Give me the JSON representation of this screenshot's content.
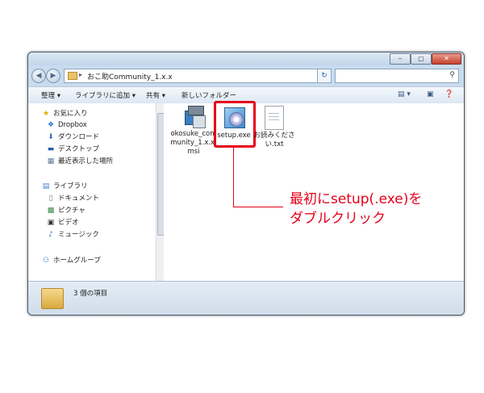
{
  "address": {
    "path": "おこ助Community_1.x.x"
  },
  "toolbar": {
    "organize": "整理 ▾",
    "add_to_library": "ライブラリに追加 ▾",
    "share": "共有 ▾",
    "new_folder": "新しいフォルダー"
  },
  "nav": {
    "favorites": "お気に入り",
    "dropbox": "Dropbox",
    "downloads": "ダウンロード",
    "desktop": "デスクトップ",
    "recent": "最近表示した場所",
    "libraries": "ライブラリ",
    "documents": "ドキュメント",
    "pictures": "ピクチャ",
    "videos": "ビデオ",
    "music": "ミュージック",
    "homegroup": "ホームグループ"
  },
  "files": [
    {
      "name": "okosuke_community_1.x.x.msi"
    },
    {
      "name": "setup.exe"
    },
    {
      "name": "お読みください.txt"
    }
  ],
  "status": {
    "count": "3 個の項目"
  },
  "annotation": {
    "line1": "最初にsetup(.exe)を",
    "line2": "ダブルクリック"
  },
  "colors": {
    "highlight": "#e5001a",
    "window_frame": "#c9dcef"
  }
}
